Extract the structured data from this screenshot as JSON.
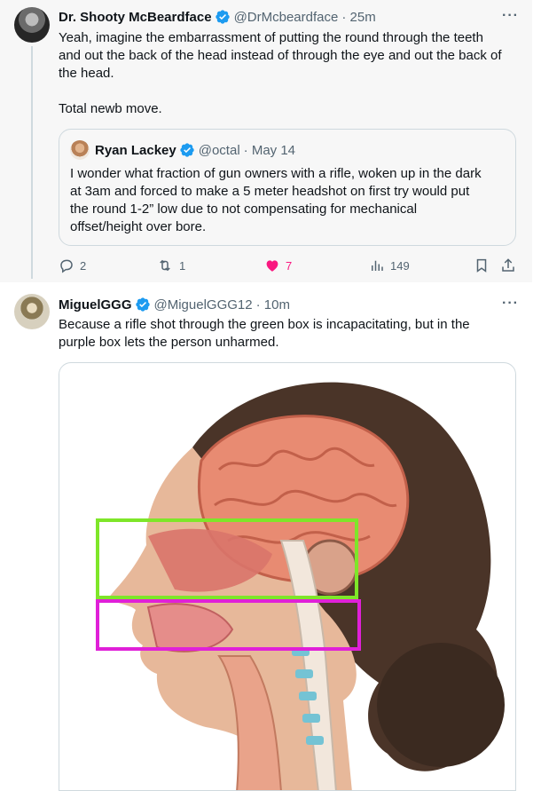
{
  "tweet1": {
    "author_name": "Dr. Shooty McBeardface",
    "handle": "@DrMcbeardface",
    "time": "· 25m",
    "text_lines": [
      "Yeah, imagine the embarrassment of putting the round through the teeth",
      "and out the back of the head instead of through the eye and out the back of",
      "the head.",
      "",
      "Total newb move."
    ],
    "quote": {
      "author_name": "Ryan Lackey",
      "handle": "@octal",
      "time": "· May 14",
      "text_lines": [
        "I wonder what fraction of gun owners with a rifle, woken up in the dark",
        "at 3am and forced to make a 5 meter headshot on first try would put",
        "the round 1-2” low due to not compensating for mechanical",
        "offset/height over bore."
      ]
    },
    "actions": {
      "replies": "2",
      "reposts": "1",
      "likes": "7",
      "views": "149"
    },
    "like_color": "#f91880"
  },
  "tweet2": {
    "author_name": "MiguelGGG",
    "handle": "@MiguelGGG12",
    "time": "· 10m",
    "text_lines": [
      "Because a rifle shot through the green box is incapacitating, but in the",
      "purple box lets the person unharmed."
    ],
    "image": {
      "description_icon": "anatomy-head-cross-section",
      "green_box_color": "#7ee629",
      "purple_box_color": "#e020d8"
    }
  },
  "ui": {
    "more_label": "···",
    "verified_color": "#1d9bf0",
    "secondary_text_color": "#536471"
  }
}
